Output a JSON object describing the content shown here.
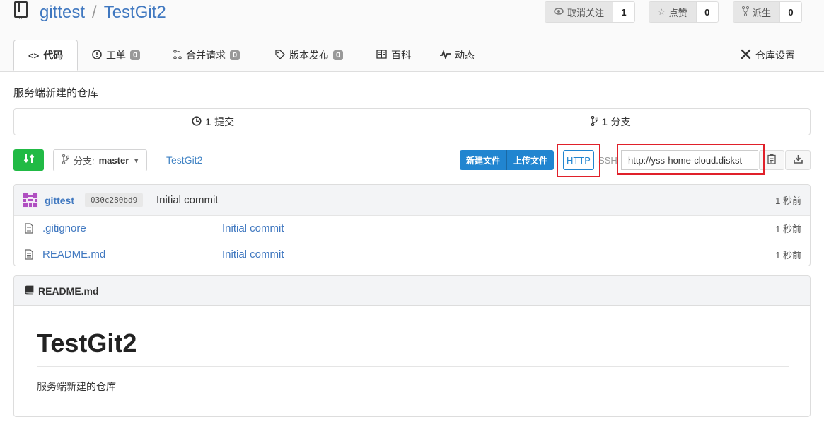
{
  "repo": {
    "owner": "gittest",
    "separator": "/",
    "name": "TestGit2",
    "description": "服务端新建的仓库"
  },
  "actions": {
    "watch": {
      "label": "取消关注",
      "count": "1",
      "icon": "eye-icon"
    },
    "star": {
      "label": "点赞",
      "count": "0",
      "icon": "star-icon"
    },
    "fork": {
      "label": "派生",
      "count": "0",
      "icon": "fork-icon"
    }
  },
  "tabs": [
    {
      "label": "代码",
      "icon": "code-icon",
      "active": true
    },
    {
      "label": "工单",
      "badge": "0",
      "icon": "issue-icon"
    },
    {
      "label": "合并请求",
      "badge": "0",
      "icon": "pull-request-icon"
    },
    {
      "label": "版本发布",
      "badge": "0",
      "icon": "tag-icon"
    },
    {
      "label": "百科",
      "icon": "book-icon"
    },
    {
      "label": "动态",
      "icon": "pulse-icon"
    }
  ],
  "settings_tab": {
    "label": "仓库设置",
    "icon": "tools-icon"
  },
  "stats": {
    "commits": {
      "count": "1",
      "label": "提交"
    },
    "branches": {
      "count": "1",
      "label": "分支"
    }
  },
  "toolbar": {
    "branch_prefix": "分支:",
    "branch_name": "master",
    "breadcrumb": "TestGit2",
    "new_file": "新建文件",
    "upload_file": "上传文件",
    "http": "HTTP",
    "ssh": "SSH",
    "clone_url": "http://yss-home-cloud.diskst"
  },
  "latest_commit": {
    "author": "gittest",
    "sha": "030c280bd9",
    "message": "Initial commit",
    "time": "1 秒前"
  },
  "files": [
    {
      "name": ".gitignore",
      "message": "Initial commit",
      "time": "1 秒前"
    },
    {
      "name": "README.md",
      "message": "Initial commit",
      "time": "1 秒前"
    }
  ],
  "readme": {
    "filename": "README.md",
    "heading": "TestGit2",
    "body": "服务端新建的仓库"
  },
  "colors": {
    "link": "#4183c4",
    "primary": "#2185d0",
    "green": "#21ba45",
    "highlight": "#e0202a"
  }
}
